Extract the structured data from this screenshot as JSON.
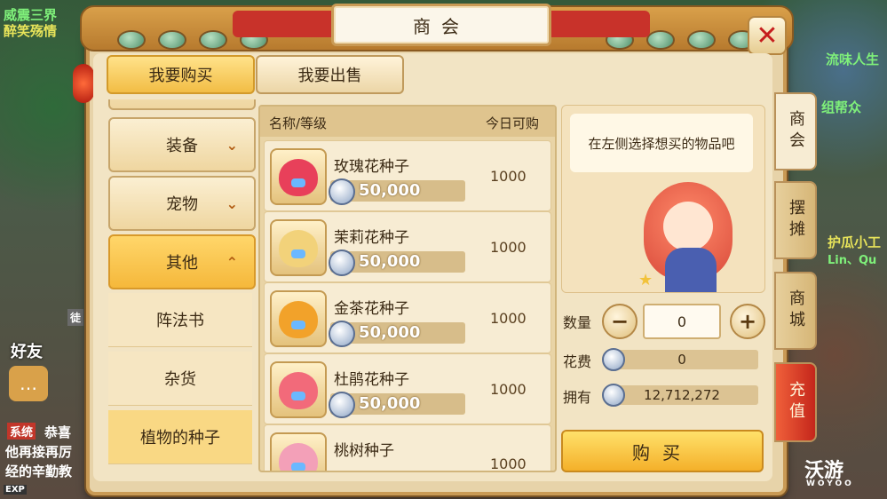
{
  "window": {
    "title": "商会",
    "close_symbol": "✕"
  },
  "background": {
    "top_left_1": "威震三界",
    "top_left_2": "醉笑殇情",
    "right_1": "流味人生",
    "right_2": "组帮众",
    "right_3": "护瓜小工",
    "right_4": "Lin、Qu",
    "left_friend": "好友",
    "left_tag": "徒",
    "chat_system": "系统",
    "chat_1": "恭喜",
    "chat_2": "他再接再厉",
    "chat_3": "经的辛勤教",
    "exp": "EXP"
  },
  "mode_tabs": {
    "buy": "我要购买",
    "sell": "我要出售"
  },
  "categories": [
    {
      "label": "装备",
      "chevron": "⌄"
    },
    {
      "label": "宠物",
      "chevron": "⌄"
    },
    {
      "label": "其他",
      "chevron": "⌃"
    }
  ],
  "subcategories": [
    "阵法书",
    "杂货",
    "植物的种子"
  ],
  "list": {
    "col_name": "名称/等级",
    "col_qty": "今日可购",
    "items": [
      {
        "name": "玫瑰花种子",
        "price": "50,000",
        "qty": "1000",
        "color": "#e8405a"
      },
      {
        "name": "茉莉花种子",
        "price": "50,000",
        "qty": "1000",
        "color": "#f2d27a"
      },
      {
        "name": "金茶花种子",
        "price": "50,000",
        "qty": "1000",
        "color": "#f2a22a"
      },
      {
        "name": "杜鹃花种子",
        "price": "50,000",
        "qty": "1000",
        "color": "#f26a7a"
      },
      {
        "name": "桃树种子",
        "price": "",
        "qty": "1000",
        "color": "#f3a0b8"
      }
    ]
  },
  "detail": {
    "hint": "在左侧选择想买的物品吧",
    "qty_label": "数量",
    "qty_value": "0",
    "minus": "−",
    "plus": "+",
    "cost_label": "花费",
    "cost_value": "0",
    "own_label": "拥有",
    "own_value": "12,712,272",
    "buy_label": "购买"
  },
  "side_tabs": [
    "商会",
    "摆摊",
    "商城",
    "充值"
  ],
  "watermark": {
    "main": "沃游",
    "sub": "WOYOO"
  }
}
